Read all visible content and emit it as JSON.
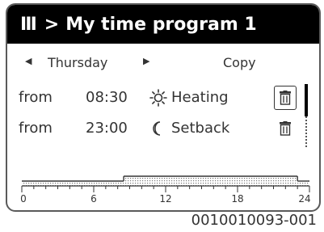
{
  "header": {
    "menu_icon": "Ⅲ",
    "separator": ">",
    "title": "My time program 1"
  },
  "day_nav": {
    "prev_arrow": "◀",
    "day": "Thursday",
    "next_arrow": "▶",
    "copy_label": "Copy"
  },
  "switch_points": [
    {
      "from_label": "from",
      "time": "08:30",
      "icon": "sun-icon",
      "mode": "Heating",
      "delete_selected": true
    },
    {
      "from_label": "from",
      "time": "23:00",
      "icon": "moon-icon",
      "mode": "Setback",
      "delete_selected": false
    }
  ],
  "timeline": {
    "ticks": [
      "0",
      "6",
      "12",
      "18",
      "24"
    ],
    "segments": [
      {
        "start": 0,
        "end": 8.5,
        "mode": "Setback"
      },
      {
        "start": 8.5,
        "end": 23,
        "mode": "Heating"
      },
      {
        "start": 23,
        "end": 24,
        "mode": "Setback"
      }
    ]
  },
  "caption": "0010010093-001"
}
